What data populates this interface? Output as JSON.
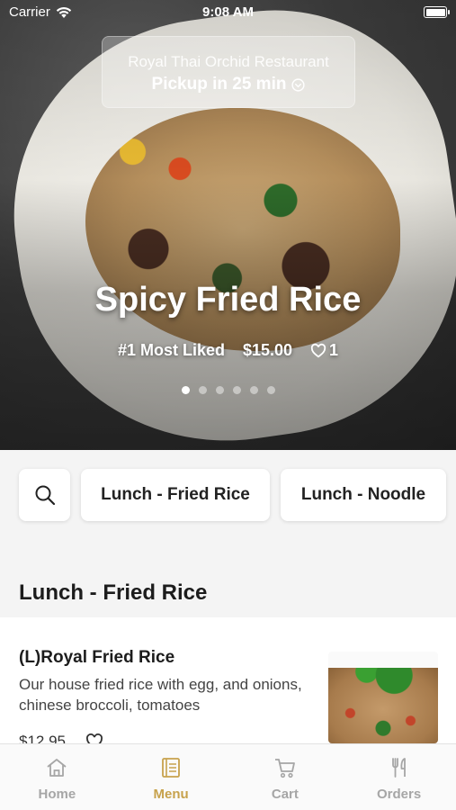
{
  "status_bar": {
    "carrier": "Carrier",
    "time": "9:08 AM"
  },
  "restaurant": {
    "name": "Royal Thai Orchid Restaurant",
    "pickup": "Pickup in 25 min"
  },
  "featured": {
    "title": "Spicy Fried Rice",
    "rank": "#1 Most Liked",
    "price": "$15.00",
    "likes": "1",
    "slide_count": 6,
    "active_slide": 1
  },
  "categories": {
    "search_icon": "search-icon",
    "items": [
      "Lunch - Fried Rice",
      "Lunch - Noodle"
    ]
  },
  "section": {
    "title": "Lunch - Fried Rice"
  },
  "menu_item": {
    "name": "(L)Royal Fried Rice",
    "description": "Our house fried rice with egg, and onions, chinese broccoli, tomatoes",
    "price": "$12.95"
  },
  "tabs": [
    {
      "label": "Home",
      "icon": "home-icon"
    },
    {
      "label": "Menu",
      "icon": "menu-book-icon",
      "active": true
    },
    {
      "label": "Cart",
      "icon": "cart-icon"
    },
    {
      "label": "Orders",
      "icon": "fork-knife-icon"
    }
  ],
  "colors": {
    "accent": "#c7a24c",
    "tab_inactive": "#a6a6a6"
  }
}
